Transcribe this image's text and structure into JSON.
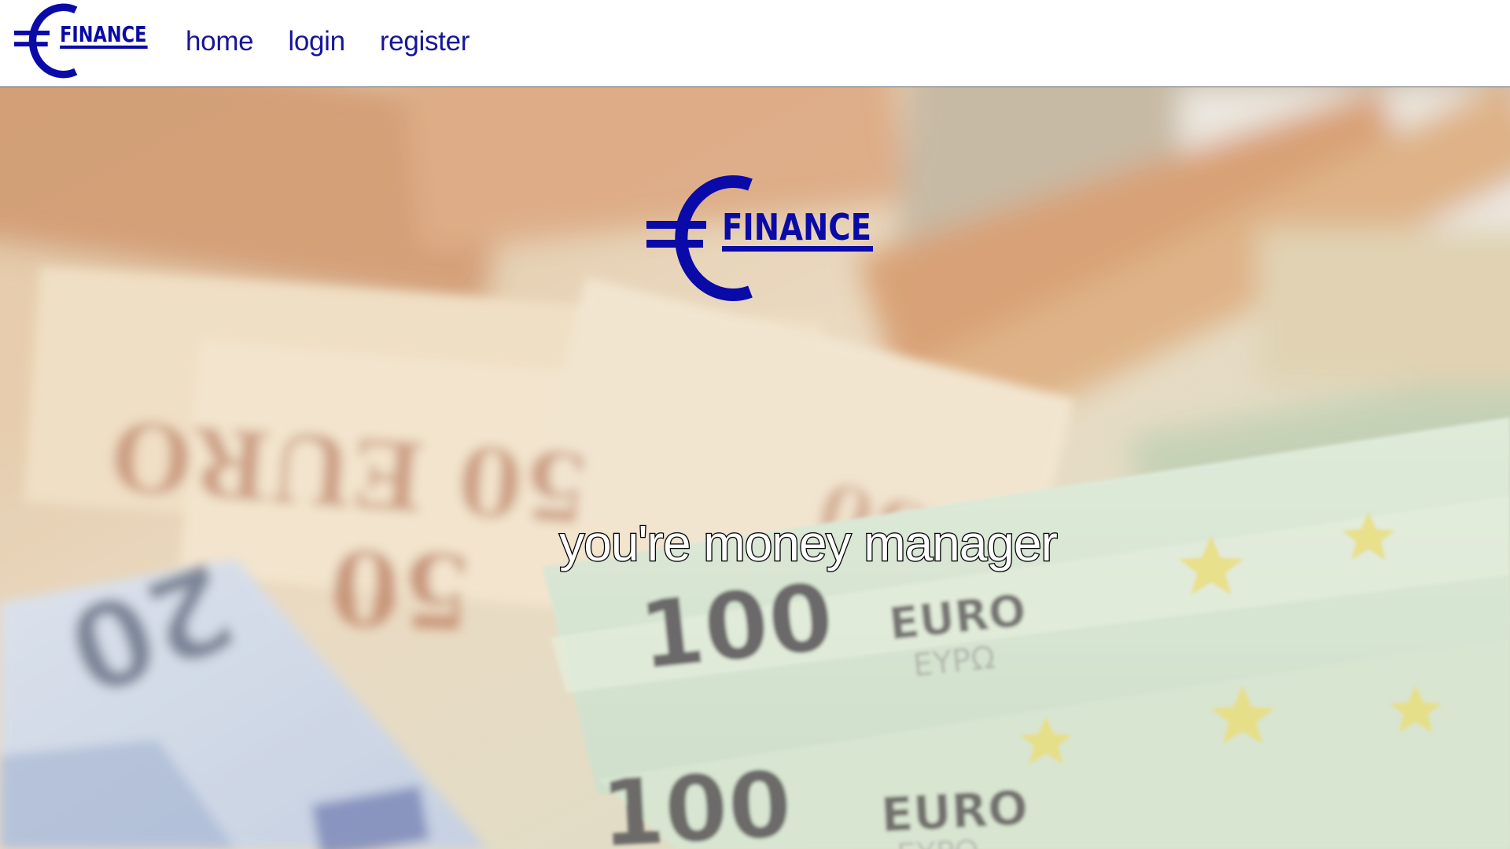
{
  "brand": {
    "name": "FINANCE",
    "symbol": "€",
    "color": "#0a0aa8"
  },
  "nav": {
    "links": [
      {
        "label": "home"
      },
      {
        "label": "login"
      },
      {
        "label": "register"
      }
    ],
    "link_color": "#16169a"
  },
  "hero": {
    "tagline": "you're money manager",
    "background": "blurred euro banknotes (20, 50, 100 EURO)"
  }
}
